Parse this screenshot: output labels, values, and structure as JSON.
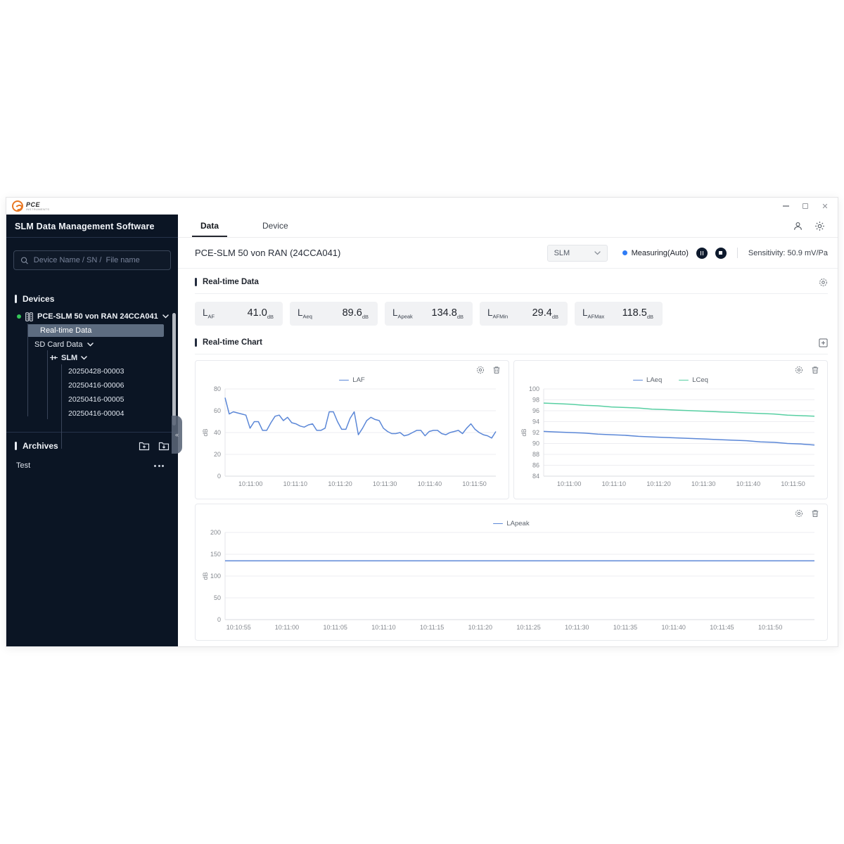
{
  "brand": {
    "name": "PCE",
    "sub": "INSTRUMENTS"
  },
  "sidebar": {
    "title": "SLM Data Management Software",
    "search_placeholder": "Device Name / SN /  File name",
    "devices_label": "Devices",
    "device_name": "PCE-SLM 50 von RAN 24CCA041",
    "tree": {
      "realtime": "Real-time Data",
      "sdcard": "SD Card Data",
      "slm": "SLM",
      "files": [
        "20250428-00003",
        "20250416-00006",
        "20250416-00005",
        "20250416-00004"
      ]
    },
    "archives_label": "Archives",
    "archive_item": "Test"
  },
  "tabs": [
    {
      "label": "Data",
      "active": true
    },
    {
      "label": "Device",
      "active": false
    }
  ],
  "header": {
    "device_title": "PCE-SLM 50 von RAN (24CCA041)",
    "mode_selected": "SLM",
    "measuring_label": "Measuring(Auto)",
    "sensitivity": "Sensitivity: 50.9 mV/Pa"
  },
  "realtime_data": {
    "section_title": "Real-time Data",
    "metrics": [
      {
        "name": "L",
        "sub": "AF",
        "value": "41.0",
        "unit": "dB"
      },
      {
        "name": "L",
        "sub": "Aeq",
        "value": "89.6",
        "unit": "dB"
      },
      {
        "name": "L",
        "sub": "Apeak",
        "value": "134.8",
        "unit": "dB"
      },
      {
        "name": "L",
        "sub": "AFMin",
        "value": "29.4",
        "unit": "dB"
      },
      {
        "name": "L",
        "sub": "AFMax",
        "value": "118.5",
        "unit": "dB"
      }
    ]
  },
  "realtime_chart": {
    "section_title": "Real-time Chart"
  },
  "chart_data": [
    {
      "type": "line",
      "ylabel": "dB",
      "ylim": [
        0,
        80
      ],
      "yticks": [
        0,
        20,
        40,
        60,
        80
      ],
      "xtick_labels": [
        "10:11:00",
        "10:11:10",
        "10:11:20",
        "10:11:30",
        "10:11:40",
        "10:11:50"
      ],
      "xtick_frac_start": 0.094,
      "xtick_frac_end": 0.921,
      "legend_position": "top",
      "grid": true,
      "series": [
        {
          "name": "LAF",
          "color": "#5b87d7",
          "values": [
            72,
            57,
            59,
            58,
            57,
            56,
            44,
            50,
            50,
            42,
            42,
            49,
            55,
            56,
            51,
            54,
            49,
            48,
            46,
            45,
            47,
            48,
            42,
            42,
            44,
            59,
            59,
            50,
            43,
            43,
            53,
            59,
            38,
            44,
            51,
            54,
            52,
            51,
            44,
            41,
            39,
            39,
            40,
            37,
            38,
            40,
            42,
            42,
            37,
            41,
            42,
            42,
            39,
            38,
            40,
            41,
            42,
            39,
            44,
            48,
            43,
            40,
            38,
            37,
            35,
            41
          ]
        }
      ]
    },
    {
      "type": "line",
      "ylabel": "dB",
      "ylim": [
        84,
        100
      ],
      "yticks": [
        84,
        86,
        88,
        90,
        92,
        94,
        96,
        98,
        100
      ],
      "xtick_labels": [
        "10:11:00",
        "10:11:10",
        "10:11:20",
        "10:11:30",
        "10:11:40",
        "10:11:50"
      ],
      "xtick_frac_start": 0.094,
      "xtick_frac_end": 0.921,
      "legend_position": "top",
      "grid": true,
      "series": [
        {
          "name": "LAeq",
          "color": "#5b87d7",
          "values": [
            92.2,
            92.1,
            92.0,
            91.9,
            91.7,
            91.6,
            91.5,
            91.3,
            91.2,
            91.1,
            91.0,
            90.9,
            90.8,
            90.7,
            90.6,
            90.5,
            90.3,
            90.2,
            90.0,
            89.9,
            89.7
          ]
        },
        {
          "name": "LCeq",
          "color": "#57cfa2",
          "values": [
            97.4,
            97.3,
            97.2,
            97.0,
            96.9,
            96.7,
            96.6,
            96.5,
            96.3,
            96.2,
            96.1,
            96.0,
            95.9,
            95.8,
            95.7,
            95.6,
            95.5,
            95.4,
            95.2,
            95.1,
            95.0
          ]
        }
      ]
    },
    {
      "type": "line",
      "ylabel": "dB",
      "ylim": [
        0,
        200
      ],
      "yticks": [
        0,
        50,
        100,
        150,
        200
      ],
      "xtick_labels": [
        "10:10:55",
        "10:11:00",
        "10:11:05",
        "10:11:10",
        "10:11:15",
        "10:11:20",
        "10:11:25",
        "10:11:30",
        "10:11:35",
        "10:11:40",
        "10:11:45",
        "10:11:50"
      ],
      "xtick_frac_start": 0.023,
      "xtick_frac_end": 0.925,
      "legend_position": "top",
      "grid": true,
      "series": [
        {
          "name": "LApeak",
          "color": "#5b87d7",
          "values": [
            134.8,
            134.8,
            134.8,
            134.8,
            134.8,
            134.8,
            134.8,
            134.8,
            134.8,
            134.8,
            134.8,
            134.8,
            134.8,
            134.8,
            134.8,
            134.8,
            134.8,
            134.8,
            134.8,
            134.8
          ]
        }
      ]
    }
  ]
}
